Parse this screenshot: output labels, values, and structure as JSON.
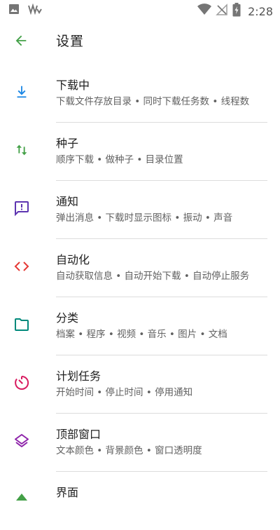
{
  "status_bar": {
    "time": "2:28"
  },
  "header": {
    "title": "设置"
  },
  "settings": [
    {
      "title": "下载中",
      "subtitle": "下载文件存放目录 • 同时下载任务数 • 线程数",
      "icon": "download-icon",
      "color": "#1E88E5"
    },
    {
      "title": "种子",
      "subtitle": "顺序下载 • 做种子 • 目录位置",
      "icon": "seed-arrows-icon",
      "color": "#43A047"
    },
    {
      "title": "通知",
      "subtitle": "弹出消息 • 下载时显示图标 • 振动 • 声音",
      "icon": "notification-icon",
      "color": "#5E35B1"
    },
    {
      "title": "自动化",
      "subtitle": "自动获取信息 • 自动开始下载 • 自动停止服务",
      "icon": "code-icon",
      "color": "#E53935"
    },
    {
      "title": "分类",
      "subtitle": "档案 • 程序 • 视频 • 音乐 • 图片 • 文档",
      "icon": "folder-icon",
      "color": "#00897B"
    },
    {
      "title": "计划任务",
      "subtitle": "开始时间 • 停止时间 • 停用通知",
      "icon": "timer-icon",
      "color": "#D81B60"
    },
    {
      "title": "顶部窗口",
      "subtitle": "文本颜色 • 背景颜色 • 窗口透明度",
      "icon": "layers-icon",
      "color": "#8E24AA"
    },
    {
      "title": "界面",
      "subtitle": "",
      "icon": "interface-icon",
      "color": "#43A047"
    }
  ]
}
